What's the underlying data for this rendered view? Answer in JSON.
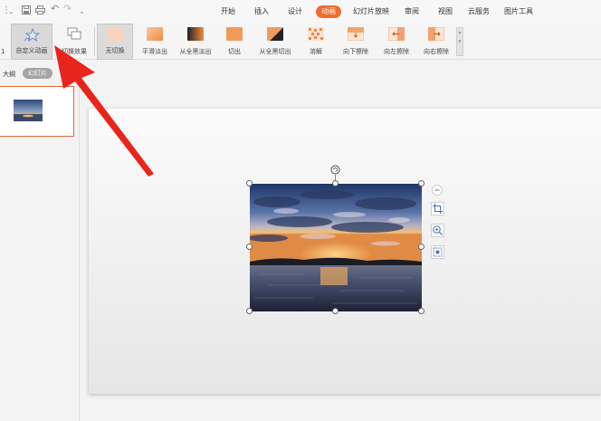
{
  "quick_access": {
    "items": [
      "save-icon",
      "print-icon",
      "undo-icon",
      "redo-icon",
      "customize-icon"
    ]
  },
  "menu": {
    "items": [
      {
        "label": "开始"
      },
      {
        "label": "插入"
      },
      {
        "label": "设计"
      },
      {
        "label": "动画",
        "active": true
      },
      {
        "label": "幻灯片放映"
      },
      {
        "label": "审阅"
      },
      {
        "label": "视图"
      },
      {
        "label": "云服务"
      },
      {
        "label": "图片工具"
      }
    ],
    "accent_color": "#f06b2f"
  },
  "ribbon": {
    "custom_animation": "自定义动画",
    "switch_effect": "切换效果",
    "transitions": [
      {
        "label": "无切换"
      },
      {
        "label": "平滑淡出"
      },
      {
        "label": "从全黑淡出"
      },
      {
        "label": "切出"
      },
      {
        "label": "从全黑切出"
      },
      {
        "label": "溶解"
      },
      {
        "label": "向下擦除"
      },
      {
        "label": "向左擦除"
      },
      {
        "label": "向右擦除"
      }
    ]
  },
  "left_panel": {
    "outline_tab": "大纲",
    "slides_tab": "幻灯片",
    "truncated_label": "1"
  },
  "annotation_color": "#e8251b"
}
